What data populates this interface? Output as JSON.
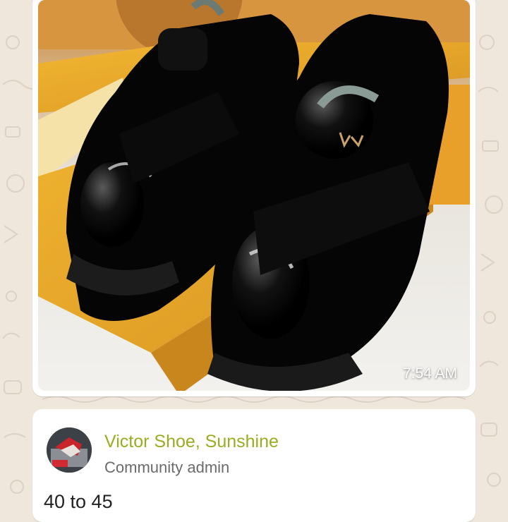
{
  "colors": {
    "wallpaper": "#efe7dc",
    "bubble": "#ffffff",
    "sender_name": "#9bac22",
    "role_text": "#6b6b6b"
  },
  "image_message": {
    "photo_icon": "shoe-photo",
    "timestamp": "7:54 AM"
  },
  "text_message": {
    "sender_name": "Victor Shoe, Sunshine",
    "sender_role": "Community admin",
    "body": "40 to 45"
  }
}
